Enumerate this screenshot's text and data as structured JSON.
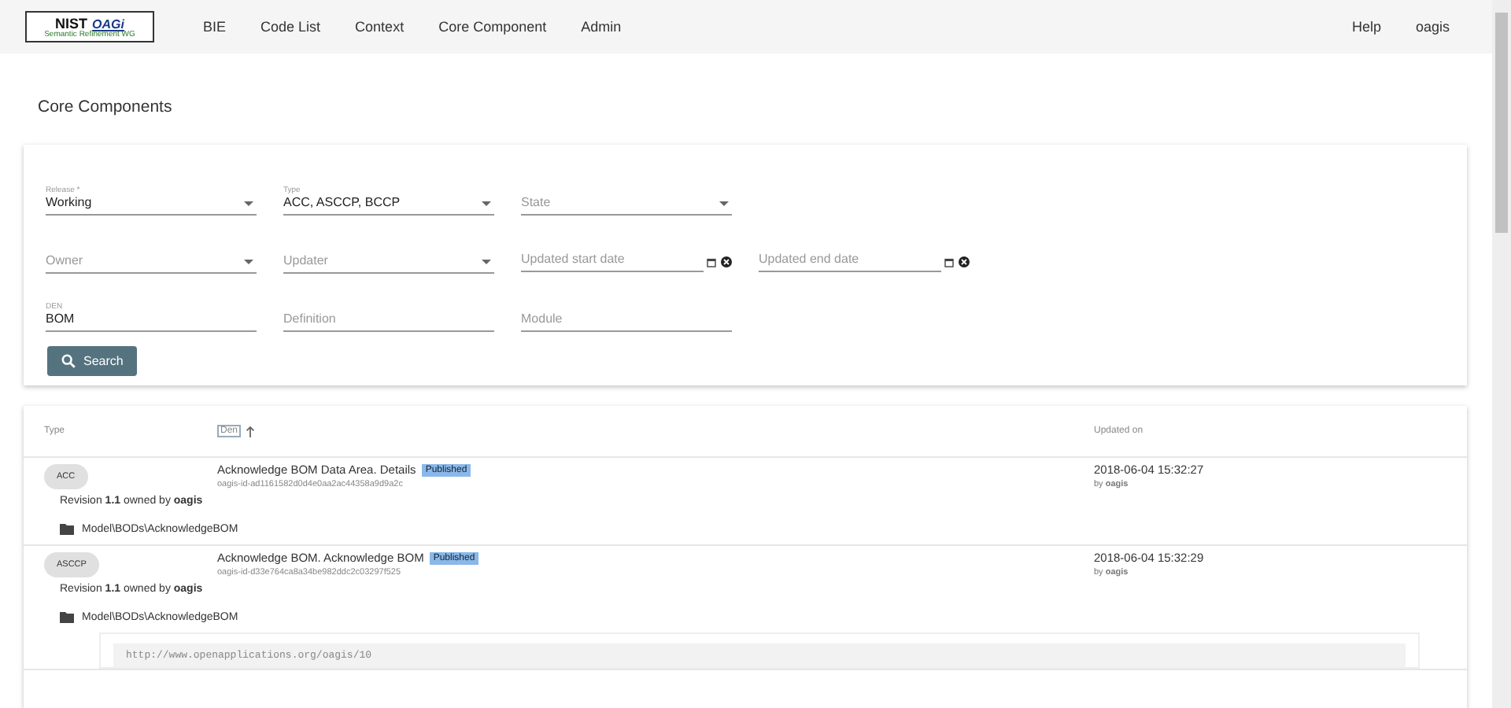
{
  "header": {
    "logo": {
      "title": "NIST",
      "brand": "OAGi",
      "subtitle": "Semantic Refinement WG"
    },
    "nav": [
      {
        "label": "BIE",
        "selected": false
      },
      {
        "label": "Code List",
        "selected": false
      },
      {
        "label": "Context",
        "selected": false
      },
      {
        "label": "Core Component",
        "selected": false
      },
      {
        "label": "Admin",
        "selected": false
      }
    ],
    "right": [
      "Help",
      "oagis"
    ]
  },
  "page_title": "Core Components",
  "filters": [
    {
      "kind": "select",
      "label": "Release *",
      "value": "Working"
    },
    {
      "kind": "select",
      "label": "Type",
      "value": "ACC, ASCCP, BCCP"
    },
    {
      "kind": "select",
      "placeholder": "State"
    },
    {
      "kind": "gap"
    },
    {
      "kind": "select",
      "placeholder": "Owner"
    },
    {
      "kind": "select",
      "placeholder": "Updater"
    },
    {
      "kind": "date",
      "placeholder": "Updated start date"
    },
    {
      "kind": "date",
      "placeholder": "Updated end date"
    },
    {
      "kind": "text",
      "label": "DEN",
      "value": "BOM"
    },
    {
      "kind": "text",
      "placeholder": "Definition"
    },
    {
      "kind": "text",
      "placeholder": "Module"
    }
  ],
  "search_button": "Search",
  "table": {
    "columns": [
      "Type",
      "Den",
      "Updated on"
    ],
    "rows": [
      {
        "type": "ACC",
        "den": "Acknowledge BOM Data Area. Details",
        "state": "Published",
        "guid": "oagis-id-ad1161582d0d4e0aa2ac44358a9d9a2c",
        "revision": "Revision **1.1** owned by **oagis**",
        "module": "Model\\BODs\\AcknowledgeBOM",
        "updated": "2018-06-04 15:32:27",
        "by": "by **oagis**"
      },
      {
        "type": "ASCCP",
        "den": "Acknowledge BOM. Acknowledge BOM",
        "state": "Published",
        "guid": "oagis-id-d33e764ca8a34be982ddc2c03297f525",
        "revision": "Revision **1.1** owned by **oagis**",
        "module": "Model\\BODs\\AcknowledgeBOM",
        "updated": "2018-06-04 15:32:29",
        "by": "by **oagis**",
        "code": "http://www.openapplications.org/oagis/10"
      }
    ]
  }
}
